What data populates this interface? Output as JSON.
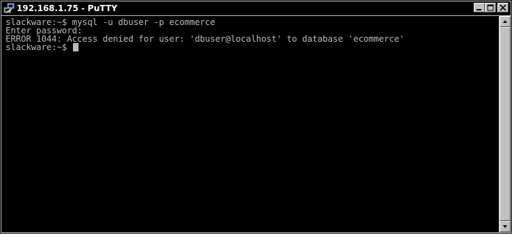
{
  "window": {
    "title": "192.168.1.75 - PuTTY",
    "icon": "putty-icon"
  },
  "titlebar_buttons": {
    "minimize_icon": "minimize-icon",
    "maximize_icon": "maximize-icon",
    "close_icon": "close-icon"
  },
  "terminal": {
    "lines": [
      "slackware:~$ mysql -u dbuser -p ecommerce",
      "Enter password:",
      "ERROR 1044: Access denied for user: 'dbuser@localhost' to database 'ecommerce'",
      "slackware:~$ "
    ],
    "foreground_color": "#bbbbbb",
    "background_color": "#000000"
  },
  "scrollbar": {
    "up_icon": "arrow-up-icon",
    "down_icon": "arrow-down-icon"
  }
}
